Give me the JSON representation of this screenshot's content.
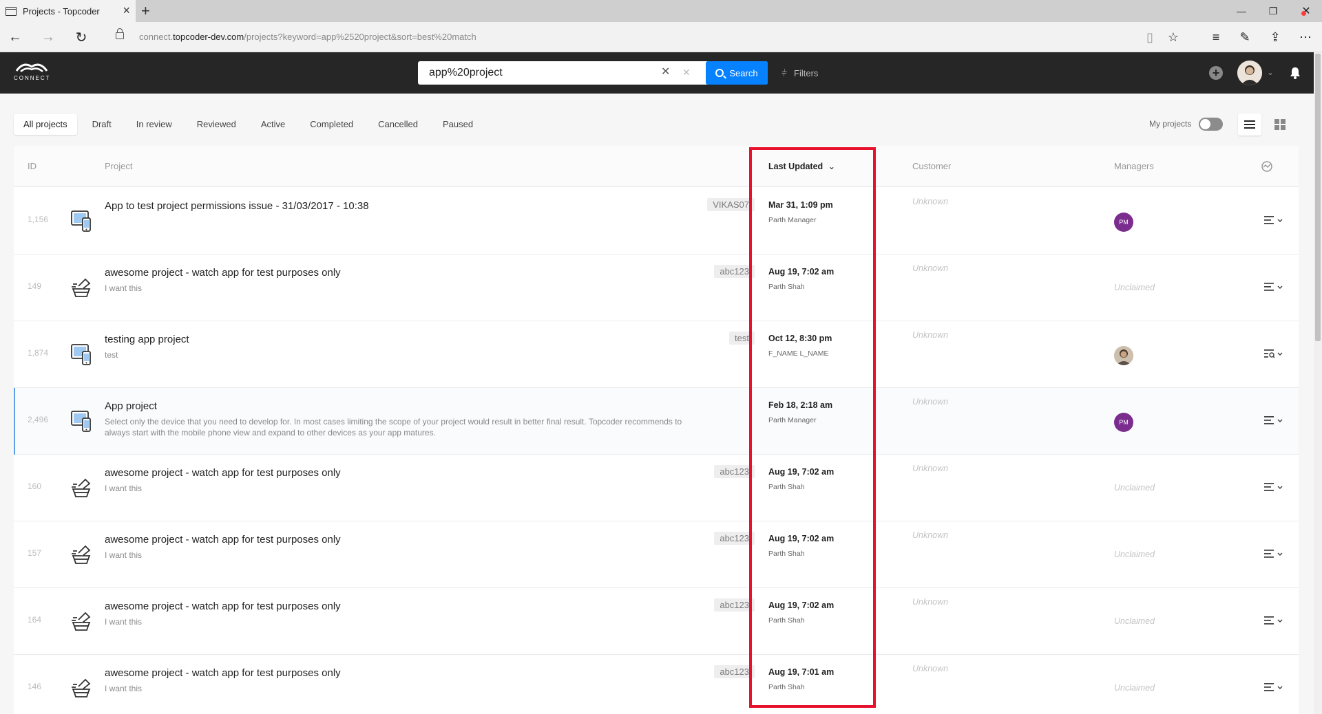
{
  "browser": {
    "tab_title": "Projects - Topcoder",
    "url_prefix": "connect.",
    "url_domain": "topcoder-dev.com",
    "url_path": "/projects?keyword=app%2520project&sort=best%20match"
  },
  "header": {
    "logo_text": "CONNECT",
    "search_value": "app%20project",
    "search_label": "Search",
    "filters_label": "Filters"
  },
  "filter_tabs": [
    "All projects",
    "Draft",
    "In review",
    "Reviewed",
    "Active",
    "Completed",
    "Cancelled",
    "Paused"
  ],
  "my_projects_label": "My projects",
  "columns": {
    "id": "ID",
    "project": "Project",
    "last_updated": "Last Updated",
    "customer": "Customer",
    "managers": "Managers"
  },
  "rows": [
    {
      "id": "1,156",
      "icon": "tablet-phone-icon",
      "name": "App to test project permissions issue - 31/03/2017 - 10:38",
      "desc": "",
      "tag": "VIKAS07",
      "date": "Mar 31, 1:09 pm",
      "by": "Parth Manager",
      "customer": "Unknown",
      "manager": "PM",
      "manager_type": "initials",
      "menu": "list-icon"
    },
    {
      "id": "149",
      "icon": "watch-app-icon",
      "name": "awesome project - watch app for test purposes only",
      "desc": "I want this",
      "tag": "abc123",
      "date": "Aug 19, 7:02 am",
      "by": "Parth Shah",
      "customer": "Unknown",
      "manager": "Unclaimed",
      "manager_type": "text",
      "menu": "list-icon"
    },
    {
      "id": "1,874",
      "icon": "tablet-phone-icon",
      "name": "testing app project",
      "desc": "test",
      "tag": "test",
      "date": "Oct 12, 8:30 pm",
      "by": "F_NAME L_NAME",
      "customer": "Unknown",
      "manager": "",
      "manager_type": "photo",
      "menu": "list-search-icon"
    },
    {
      "id": "2,496",
      "icon": "tablet-phone-icon",
      "name": "App project",
      "desc": "Select only the device that you need to develop for. In most cases limiting the scope of your project would result in better final result. Topcoder recommends to always start with the mobile phone view and expand to other devices as your app matures.",
      "tag": "",
      "date": "Feb 18, 2:18 am",
      "by": "Parth Manager",
      "customer": "Unknown",
      "manager": "PM",
      "manager_type": "initials",
      "menu": "list-icon"
    },
    {
      "id": "160",
      "icon": "watch-app-icon",
      "name": "awesome project - watch app for test purposes only",
      "desc": "I want this",
      "tag": "abc123",
      "date": "Aug 19, 7:02 am",
      "by": "Parth Shah",
      "customer": "Unknown",
      "manager": "Unclaimed",
      "manager_type": "text",
      "menu": "list-icon"
    },
    {
      "id": "157",
      "icon": "watch-app-icon",
      "name": "awesome project - watch app for test purposes only",
      "desc": "I want this",
      "tag": "abc123",
      "date": "Aug 19, 7:02 am",
      "by": "Parth Shah",
      "customer": "Unknown",
      "manager": "Unclaimed",
      "manager_type": "text",
      "menu": "list-icon"
    },
    {
      "id": "164",
      "icon": "watch-app-icon",
      "name": "awesome project - watch app for test purposes only",
      "desc": "I want this",
      "tag": "abc123",
      "date": "Aug 19, 7:02 am",
      "by": "Parth Shah",
      "customer": "Unknown",
      "manager": "Unclaimed",
      "manager_type": "text",
      "menu": "list-icon"
    },
    {
      "id": "146",
      "icon": "watch-app-icon",
      "name": "awesome project - watch app for test purposes only",
      "desc": "I want this",
      "tag": "abc123",
      "date": "Aug 19, 7:01 am",
      "by": "Parth Shah",
      "customer": "Unknown",
      "manager": "Unclaimed",
      "manager_type": "text",
      "menu": "list-icon"
    }
  ],
  "colors": {
    "header_bg": "#262626",
    "search_button": "#0681ff",
    "manager_avatar": "#7b2d8e",
    "annotation_border": "#e8112d",
    "notification_dot": "#ff3b3b"
  }
}
